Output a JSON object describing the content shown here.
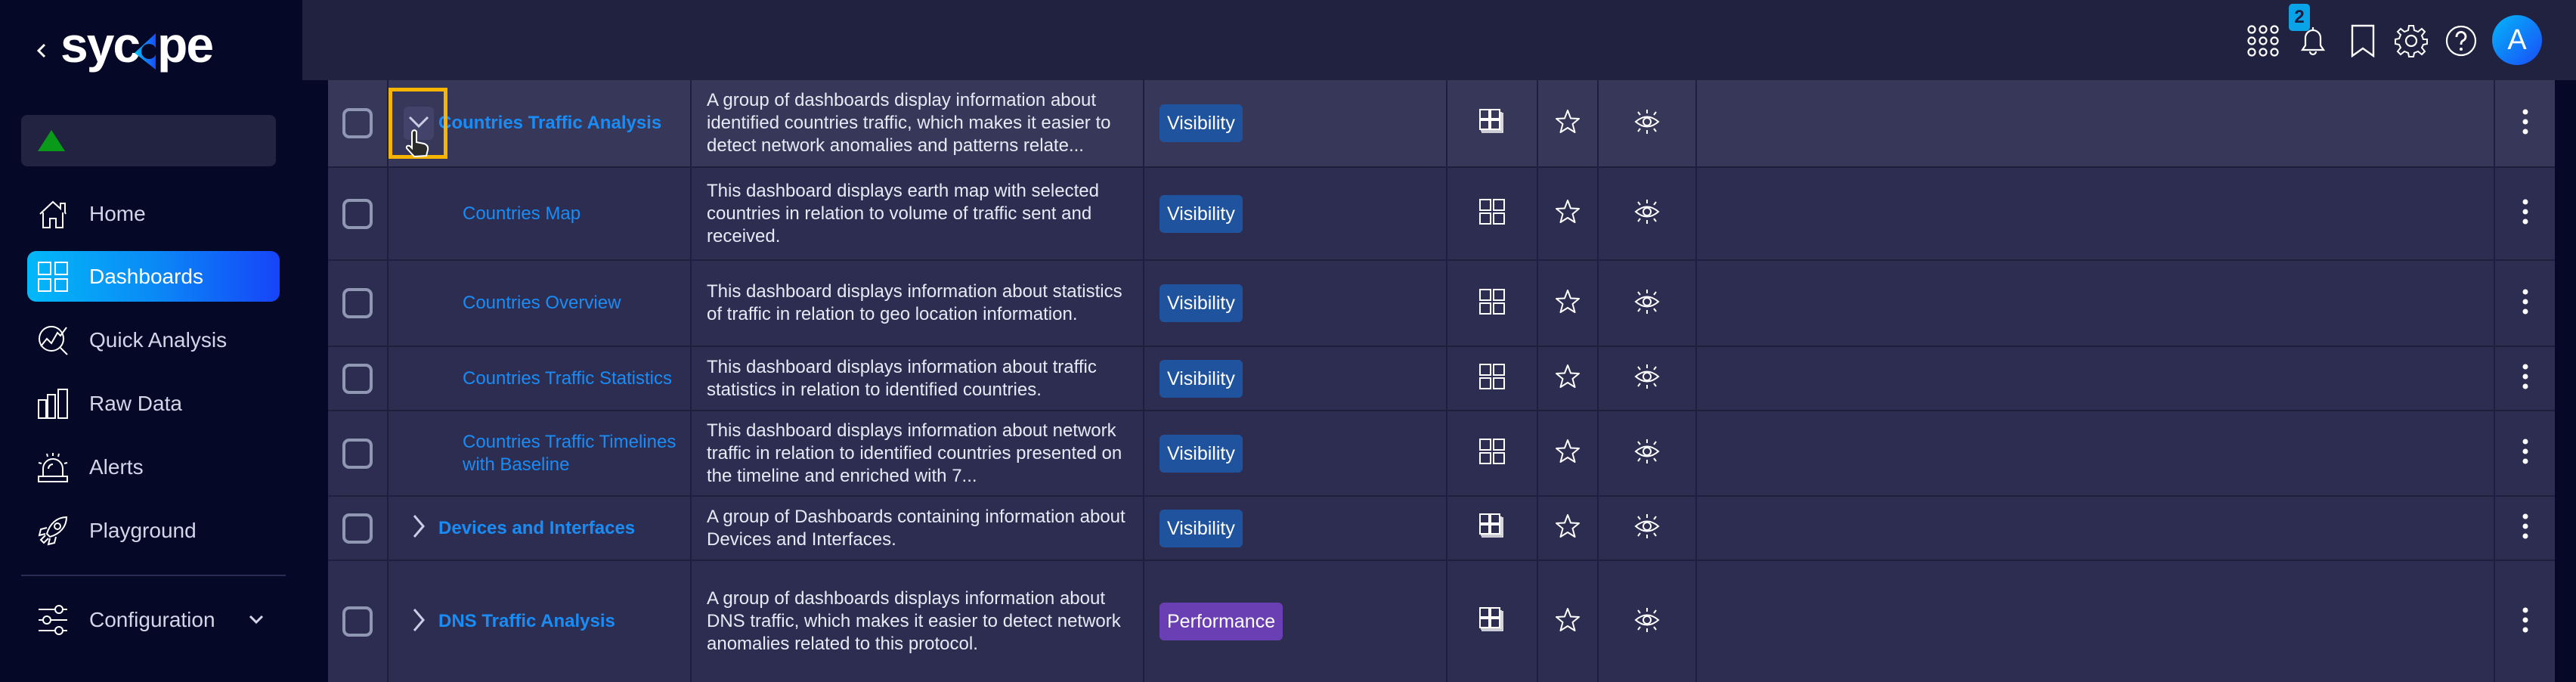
{
  "sidebar": {
    "logo_text": "sycope",
    "collapse_icon": "chevron-left-icon",
    "status_icon": "green-triangle-icon",
    "items": [
      {
        "label": "Home",
        "icon": "home-icon",
        "active": false
      },
      {
        "label": "Dashboards",
        "icon": "dashboards-grid-icon",
        "active": true
      },
      {
        "label": "Quick Analysis",
        "icon": "quick-analysis-icon",
        "active": false
      },
      {
        "label": "Raw Data",
        "icon": "bar-chart-icon",
        "active": false
      },
      {
        "label": "Alerts",
        "icon": "alarm-siren-icon",
        "active": false
      },
      {
        "label": "Playground",
        "icon": "rocket-icon",
        "active": false
      }
    ],
    "config": {
      "label": "Configuration",
      "icon": "sliders-icon",
      "chevron": "chevron-down-icon"
    }
  },
  "header": {
    "icons": [
      "apps-grid-icon",
      "bell-icon",
      "bookmark-icon",
      "gear-icon",
      "help-icon"
    ],
    "notification_count": "2",
    "avatar_initial": "A"
  },
  "colors": {
    "accent": "#1a8cf5",
    "visibility_tag": "#20539e",
    "performance_tag": "#6a3fb3",
    "focus_ring": "#f7b500",
    "status_green": "#0a9a1a"
  },
  "table": {
    "rows": [
      {
        "type": "group",
        "expanded": true,
        "highlighted": true,
        "name": "Countries Traffic Analysis",
        "description": "A group of dashboards display information about identified countries traffic, which makes it easier to detect network anomalies and patterns relate...",
        "category": "Visibility"
      },
      {
        "type": "child",
        "name": "Countries Map",
        "description": "This dashboard displays earth map with selected countries in relation to volume of traffic sent and received.",
        "category": "Visibility"
      },
      {
        "type": "child",
        "name": "Countries Overview",
        "description": "This dashboard displays information about statistics of traffic in relation to geo location information.",
        "category": "Visibility"
      },
      {
        "type": "child",
        "name": "Countries Traffic Statistics",
        "description": "This dashboard displays information about traffic statistics in relation to identified countries.",
        "category": "Visibility"
      },
      {
        "type": "child",
        "name": "Countries Traffic Timelines with Baseline",
        "description": "This dashboard displays information about network traffic in relation to identified countries presented on the timeline and enriched with 7...",
        "category": "Visibility"
      },
      {
        "type": "group",
        "expanded": false,
        "name": "Devices and Interfaces",
        "description": "A group of Dashboards containing information about Devices and Interfaces.",
        "category": "Visibility"
      },
      {
        "type": "group",
        "expanded": false,
        "name": "DNS Traffic Analysis",
        "description": "A group of dashboards displays information about DNS traffic, which makes it easier to detect network anomalies related to this protocol.",
        "category": "Performance"
      }
    ]
  }
}
